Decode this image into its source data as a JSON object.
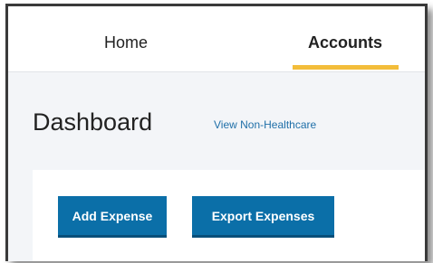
{
  "nav": {
    "tabs": [
      {
        "label": "Home",
        "active": false
      },
      {
        "label": "Accounts",
        "active": true
      }
    ],
    "active_indicator_color": "#f3bd3a"
  },
  "header": {
    "title": "Dashboard",
    "view_link": "View Non-Healthcare"
  },
  "actions": {
    "add_expense_label": "Add Expense",
    "export_expenses_label": "Export Expenses",
    "button_color": "#0b6fa8"
  }
}
